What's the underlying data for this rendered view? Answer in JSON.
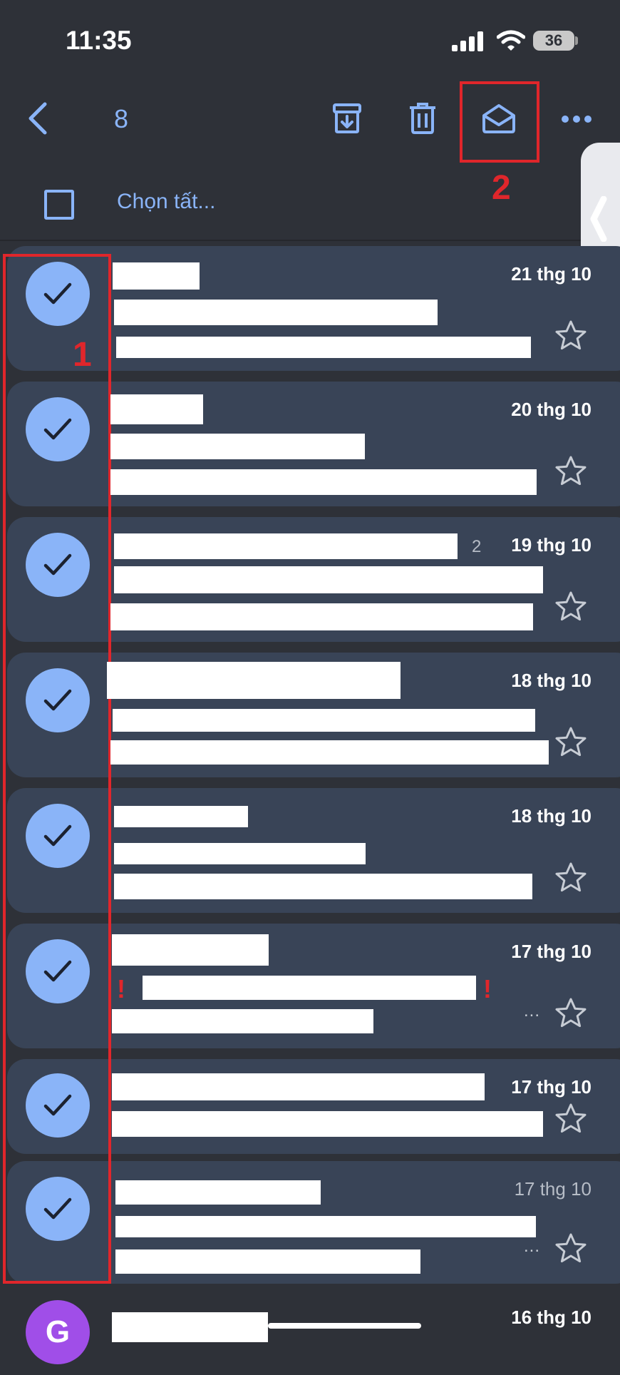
{
  "status_bar": {
    "time": "11:35",
    "battery": "36"
  },
  "toolbar": {
    "selected_count": "8",
    "back_icon": "chevron-left-icon",
    "archive_icon": "archive-icon",
    "delete_icon": "trash-icon",
    "mark_read_icon": "envelope-open-icon",
    "more_icon": "more-horizontal-icon",
    "select_all_label": "Chọn tất..."
  },
  "annotations": {
    "label_1": "1",
    "label_2": "2"
  },
  "emails": [
    {
      "date": "21 thg 10",
      "selected": true,
      "unread": true
    },
    {
      "date": "20 thg 10",
      "selected": true,
      "unread": true
    },
    {
      "date": "19 thg 10",
      "selected": true,
      "unread": true,
      "thread_count": "2"
    },
    {
      "date": "18 thg 10",
      "selected": true,
      "unread": true
    },
    {
      "date": "18 thg 10",
      "selected": true,
      "unread": true
    },
    {
      "date": "17 thg 10",
      "selected": true,
      "unread": true,
      "important": true,
      "has_more": "..."
    },
    {
      "date": "17 thg 10",
      "selected": true,
      "unread": true
    },
    {
      "date": "17 thg 10",
      "selected": true,
      "unread": false,
      "has_more": "..."
    },
    {
      "date": "16 thg 10",
      "selected": false,
      "unread": true,
      "avatar_letter": "G"
    }
  ],
  "colors": {
    "accent": "#8ab4f8",
    "background": "#2e3138",
    "selected_row": "#394457",
    "annotation": "#e0262b",
    "avatar": "#a04ee8"
  }
}
